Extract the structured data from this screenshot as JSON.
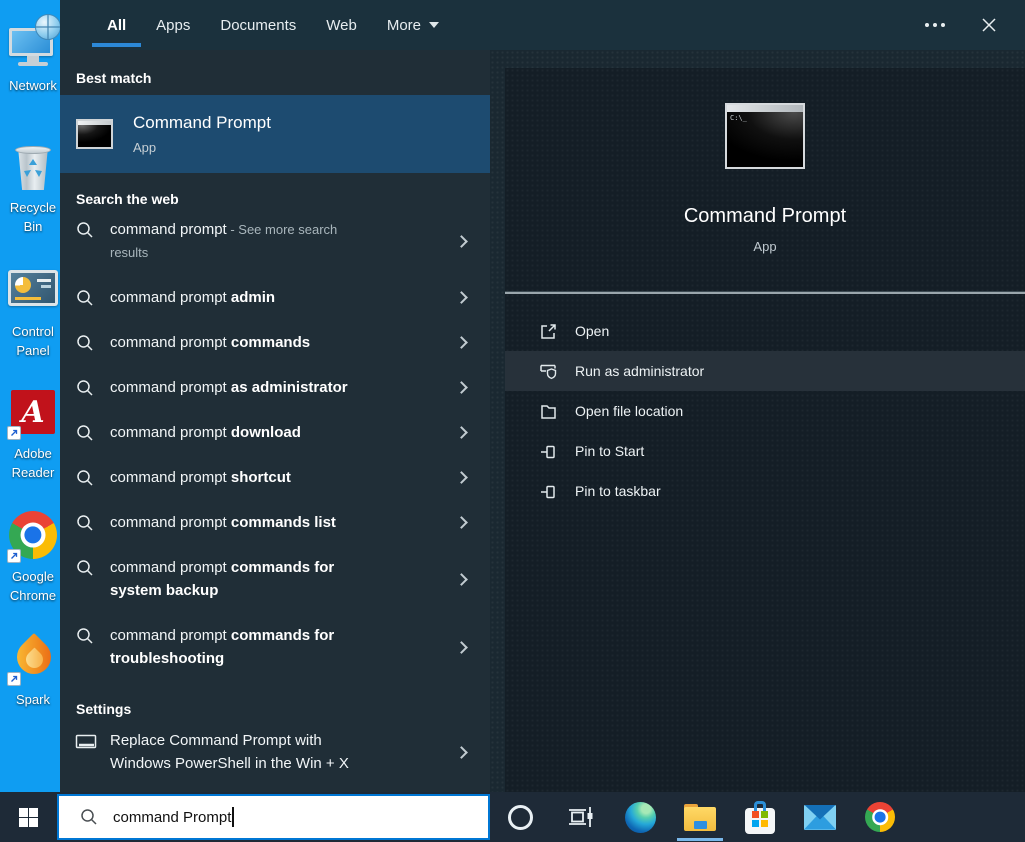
{
  "colors": {
    "accent": "#0077d4",
    "tab_underline": "#2c89d8",
    "best_match_highlight": "#1d4b70",
    "window_bg": "#202e37",
    "pane_bg": "#141e26",
    "taskbar_bg": "#1e2a37",
    "desktop_bg": "#0f9df2",
    "explorer_indicator": "#79b7e9"
  },
  "window": {
    "tabs": [
      {
        "label": "All",
        "active": true
      },
      {
        "label": "Apps",
        "active": false
      },
      {
        "label": "Documents",
        "active": false
      },
      {
        "label": "Web",
        "active": false
      },
      {
        "label": "More",
        "active": false,
        "has_dropdown": true
      }
    ]
  },
  "left": {
    "best_match": {
      "header": "Best match",
      "title": "Command Prompt",
      "subtitle": "App"
    },
    "search_web_header": "Search the web",
    "suggestions": [
      {
        "normal": "command prompt",
        "bold": "",
        "light": " - See more search results"
      },
      {
        "normal": "command prompt ",
        "bold": "admin",
        "light": ""
      },
      {
        "normal": "command prompt ",
        "bold": "commands",
        "light": ""
      },
      {
        "normal": "command prompt ",
        "bold": "as administrator",
        "light": ""
      },
      {
        "normal": "command prompt ",
        "bold": "download",
        "light": ""
      },
      {
        "normal": "command prompt ",
        "bold": "shortcut",
        "light": ""
      },
      {
        "normal": "command prompt ",
        "bold": "commands list",
        "light": ""
      },
      {
        "normal": "command prompt ",
        "bold": "commands for system backup",
        "light": ""
      },
      {
        "normal": "command prompt ",
        "bold": "commands for troubleshooting",
        "light": ""
      }
    ],
    "settings_header": "Settings",
    "settings_item": "Replace Command Prompt with Windows PowerShell in the Win + X"
  },
  "preview": {
    "title": "Command Prompt",
    "subtitle": "App",
    "cmd_icon_text": "C:\\_",
    "actions": [
      {
        "label": "Open",
        "icon": "open-icon",
        "highlighted": false
      },
      {
        "label": "Run as administrator",
        "icon": "admin-shield-icon",
        "highlighted": true
      },
      {
        "label": "Open file location",
        "icon": "folder-location-icon",
        "highlighted": false
      },
      {
        "label": "Pin to Start",
        "icon": "pin-icon",
        "highlighted": false
      },
      {
        "label": "Pin to taskbar",
        "icon": "pin-icon",
        "highlighted": false
      }
    ]
  },
  "taskbar": {
    "search_value": "command Prompt",
    "icons": [
      "start",
      "cortana",
      "task-view",
      "edge",
      "file-explorer",
      "store",
      "mail",
      "chrome"
    ],
    "open_app_indicator": "file-explorer"
  },
  "desktop": {
    "icons": [
      {
        "label": "Network"
      },
      {
        "label": "Recycle Bin"
      },
      {
        "label": "Control Panel"
      },
      {
        "label": "Adobe Reader"
      },
      {
        "label": "Google Chrome"
      },
      {
        "label": "Spark"
      }
    ]
  }
}
